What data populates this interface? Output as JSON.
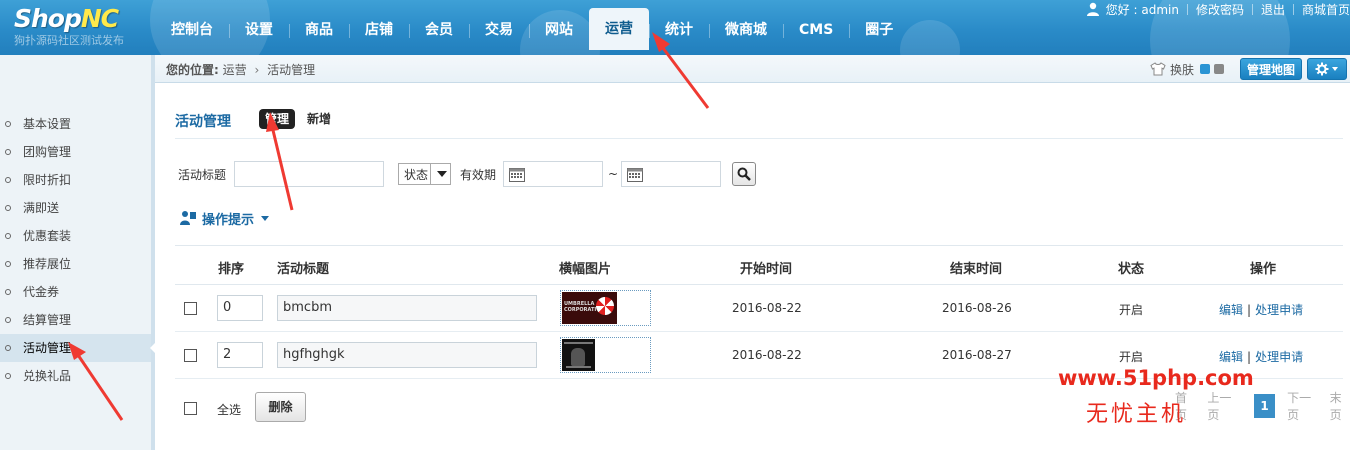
{
  "brand": {
    "logo_main": "Shop",
    "logo_accent": "NC",
    "logo_sub": "狗扑源码社区测试发布"
  },
  "nav": {
    "items": [
      "控制台",
      "设置",
      "商品",
      "店铺",
      "会员",
      "交易",
      "网站",
      "运营",
      "统计",
      "微商城",
      "CMS",
      "圈子"
    ],
    "active": "运营"
  },
  "user": {
    "greeting": "您好 : admin",
    "change_password": "修改密码",
    "logout": "退出",
    "store_home": "商城首页"
  },
  "breadcrumb": {
    "lead": "您的位置:",
    "level1": "运营",
    "level2": "活动管理"
  },
  "toolbar": {
    "skin_label": "换肤",
    "map_button": "管理地图"
  },
  "sidebar": {
    "items": [
      "基本设置",
      "团购管理",
      "限时折扣",
      "满即送",
      "优惠套装",
      "推荐展位",
      "代金券",
      "结算管理",
      "活动管理",
      "兑换礼品"
    ],
    "active": "活动管理"
  },
  "page": {
    "title": "活动管理",
    "tab_manage": "管理",
    "tab_add": "新增"
  },
  "search": {
    "title_label": "活动标题",
    "title_value": "",
    "status_value": "状态",
    "valid_label": "有效期",
    "tilde": "~"
  },
  "tips": {
    "label": "操作提示"
  },
  "table": {
    "columns": [
      "排序",
      "活动标题",
      "横幅图片",
      "开始时间",
      "结束时间",
      "状态",
      "操作"
    ],
    "rows": [
      {
        "sort": "0",
        "title": "bmcbm",
        "banner": "UMBRELLA CORPORATION",
        "start": "2016-08-22",
        "end": "2016-08-26",
        "status": "开启",
        "edit": "编辑",
        "handle": "处理申请"
      },
      {
        "sort": "2",
        "title": "hgfhghgk",
        "banner": "",
        "start": "2016-08-22",
        "end": "2016-08-27",
        "status": "开启",
        "edit": "编辑",
        "handle": "处理申请"
      }
    ],
    "op_sep": "|"
  },
  "footer": {
    "select_all": "全选",
    "delete": "删除"
  },
  "pager": {
    "first": "首页",
    "prev": "上一页",
    "current": "1",
    "next": "下一页",
    "last": "末页"
  },
  "watermark": {
    "url": "www.51php.com",
    "name": "无忧主机"
  },
  "colors": {
    "header_blue": "#2a8bc8",
    "link_blue": "#1c6aa3",
    "arrow_red": "#ef3a32",
    "watermark_red": "#e8291d"
  }
}
